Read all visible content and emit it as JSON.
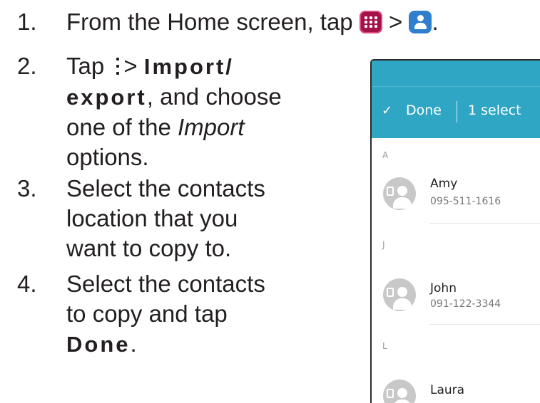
{
  "steps": [
    {
      "num": "1.",
      "text_a": "From the Home screen, tap",
      "gt": ">",
      "end": "."
    },
    {
      "num": "2.",
      "tap": "Tap",
      "gt": ">",
      "bold_a": "Import/",
      "bold_b": "export",
      "text_a": ", and choose",
      "text_b": "one of the",
      "italic": "Import",
      "text_c": "options."
    },
    {
      "num": "3.",
      "line1": "Select the contacts",
      "line2": "location that you",
      "line3": "want to copy to."
    },
    {
      "num": "4.",
      "line1": "Select the contacts",
      "line2": "to copy and tap",
      "bold": "Done",
      "end": "."
    }
  ],
  "icons": {
    "apps": "apps-grid-icon",
    "contacts": "contacts-person-icon",
    "menu": "more-options-icon",
    "apps_color": "#a3134a",
    "contacts_color": "#2f7fcd",
    "appbar_color": "#2fa6c4"
  },
  "phone": {
    "check": "✓",
    "done_label": "Done",
    "selected_label": "1 select",
    "sections": [
      "A",
      "J",
      "L"
    ],
    "contacts": [
      {
        "name": "Amy",
        "phone": "095-511-1616"
      },
      {
        "name": "John",
        "phone": "091-122-3344"
      },
      {
        "name": "Laura",
        "phone": ""
      }
    ]
  }
}
